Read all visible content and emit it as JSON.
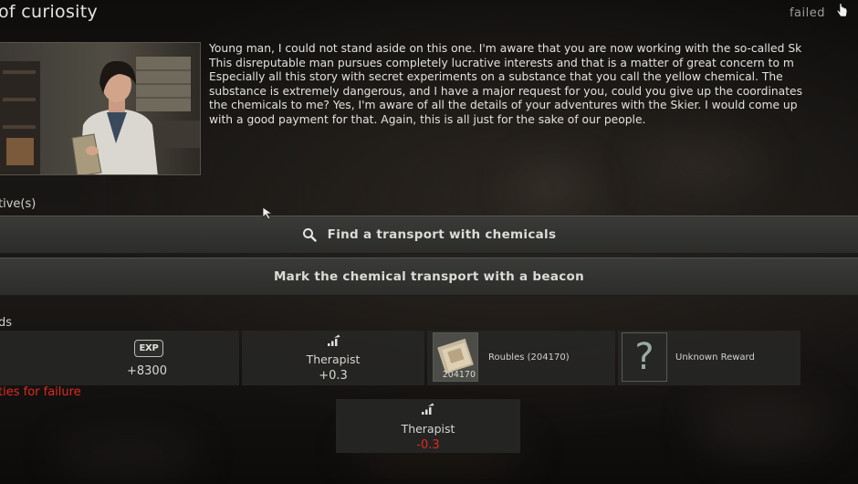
{
  "quest": {
    "title": "of curiosity",
    "status": "failed",
    "description": "Young man, I could not stand aside on this one. I'm aware that you are now working with the so-called Sk\nThis disreputable man pursues completely lucrative interests and that is a matter of great concern to m\nEspecially all this story with secret experiments on a substance that you call the yellow chemical. The\nsubstance is extremely dangerous, and I have a major request for you, could you give up the coordinates\nthe chemicals to me? Yes, I'm aware of all the details of your adventures with the Skier. I would come up\nwith a good payment for that. Again, this is all just for the sake of our people."
  },
  "objectives": {
    "label": "tive(s)",
    "items": [
      {
        "text": "Find a transport with chemicals",
        "icon": "search-icon"
      },
      {
        "text": "Mark the chemical transport with a beacon"
      }
    ]
  },
  "rewards": {
    "label": "ds",
    "exp_badge": "EXP",
    "exp_value": "+8300",
    "trader_name": "Therapist",
    "trader_value": "+0.3",
    "item_name": "Roubles (204170)",
    "item_count": "204170",
    "unknown_glyph": "?",
    "unknown_label": "Unknown Reward"
  },
  "failure": {
    "label": "ties for failure",
    "trader_name": "Therapist",
    "trader_value": "-0.3"
  },
  "colors": {
    "penalty": "#e0291e",
    "panel": "#2c2c2b",
    "text": "#d6d6d2"
  }
}
